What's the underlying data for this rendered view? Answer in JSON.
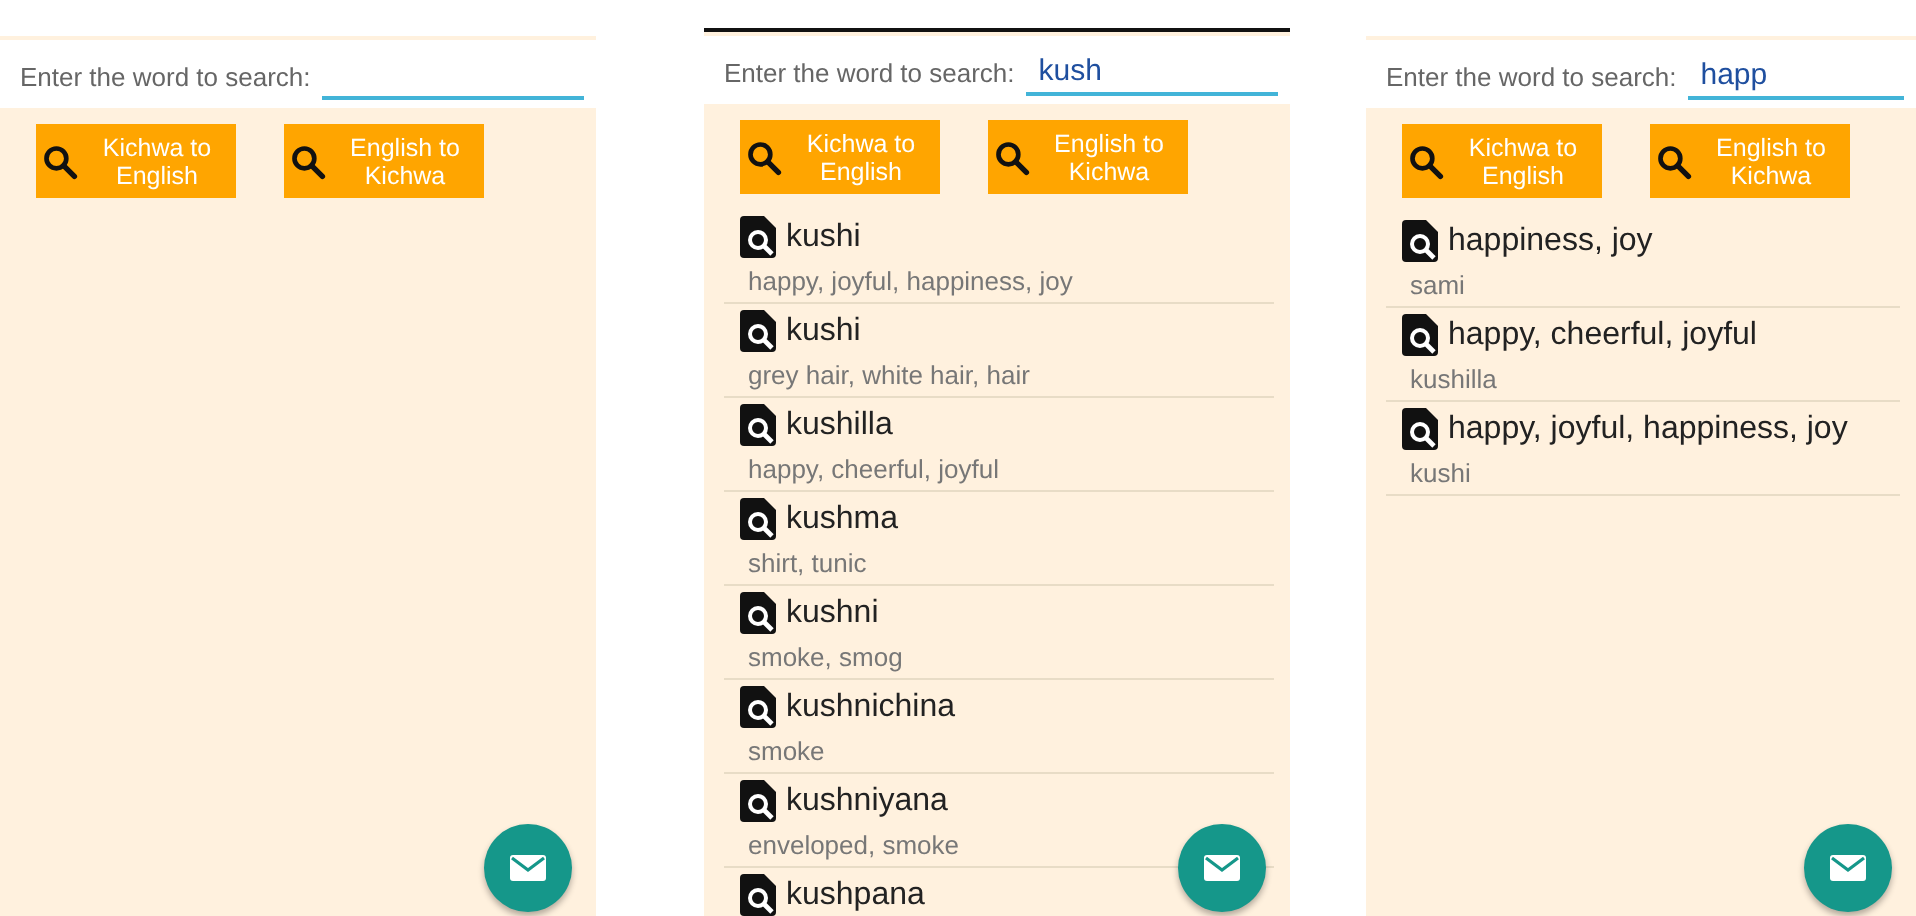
{
  "screens": [
    {
      "search_label": "Enter the word to search:",
      "buttons": [
        "Kichwa to English",
        "English to Kichwa"
      ]
    },
    {
      "search_label": "Enter the word to search:",
      "query": "kush",
      "buttons": [
        "Kichwa to English",
        "English to Kichwa"
      ],
      "results": [
        {
          "word": "kushi",
          "meaning": "happy, joyful, happiness, joy"
        },
        {
          "word": "kushi",
          "meaning": "grey hair, white hair, hair"
        },
        {
          "word": "kushilla",
          "meaning": "happy, cheerful, joyful"
        },
        {
          "word": "kushma",
          "meaning": "shirt, tunic"
        },
        {
          "word": "kushni",
          "meaning": "smoke, smog"
        },
        {
          "word": "kushnichina",
          "meaning": "smoke"
        },
        {
          "word": "kushniyana",
          "meaning": "enveloped, smoke"
        },
        {
          "word": "kushpana"
        }
      ]
    },
    {
      "search_label": "Enter the word to search:",
      "query": "happ",
      "buttons": [
        "Kichwa to English",
        "English to Kichwa"
      ],
      "results": [
        {
          "word": "happiness, joy",
          "meaning": "sami"
        },
        {
          "word": "happy, cheerful, joyful",
          "meaning": "kushilla"
        },
        {
          "word": "happy, joyful, happiness, joy",
          "meaning": "kushi"
        }
      ]
    }
  ]
}
